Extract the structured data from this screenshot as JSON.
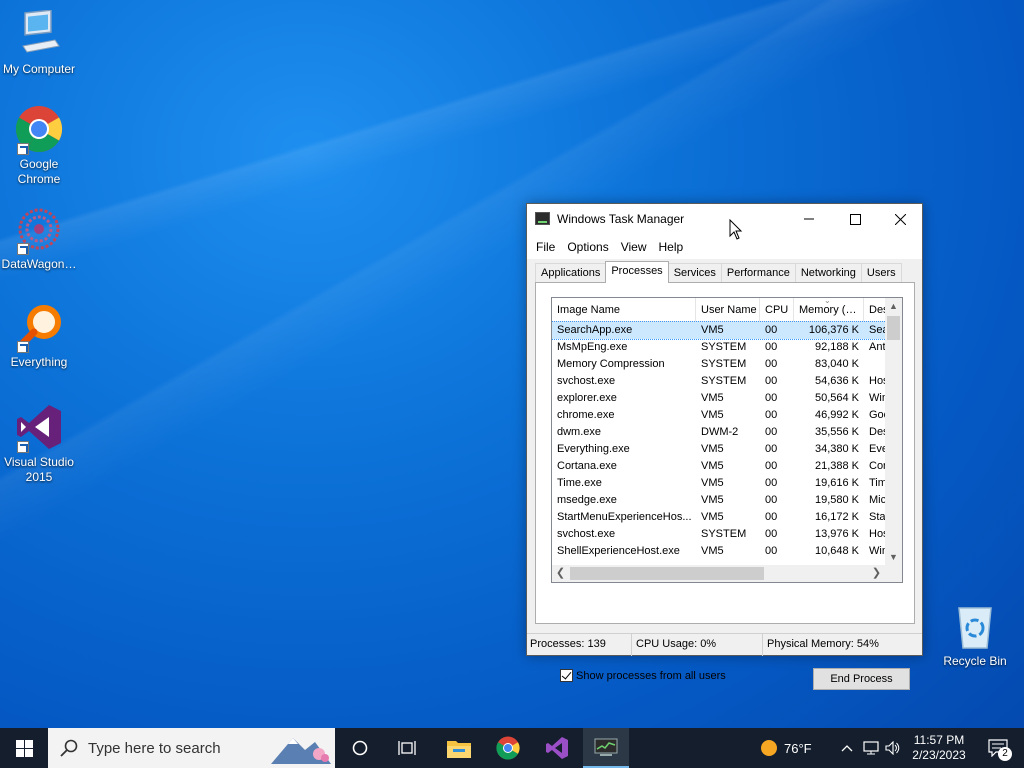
{
  "desktop": {
    "icons": [
      {
        "label": "My Computer",
        "icon": "computer-icon"
      },
      {
        "label": "Google Chrome",
        "icon": "chrome-icon"
      },
      {
        "label": "DataWagon…",
        "icon": "datawagon-icon"
      },
      {
        "label": "Everything",
        "icon": "everything-search-icon"
      },
      {
        "label": "Visual Studio 2015",
        "icon": "visual-studio-icon"
      },
      {
        "label": "Recycle Bin",
        "icon": "recycle-bin-icon"
      }
    ]
  },
  "window": {
    "title": "Windows Task Manager",
    "menu": [
      "File",
      "Options",
      "View",
      "Help"
    ],
    "tabs": [
      "Applications",
      "Processes",
      "Services",
      "Performance",
      "Networking",
      "Users"
    ],
    "active_tab": "Processes",
    "columns": [
      "Image Name",
      "User Name",
      "CPU",
      "Memory (…",
      "Des"
    ],
    "rows": [
      [
        "SearchApp.exe",
        "VM5",
        "00",
        "106,376 K",
        "Sea"
      ],
      [
        "MsMpEng.exe",
        "SYSTEM",
        "00",
        "92,188 K",
        "Ant"
      ],
      [
        "Memory Compression",
        "SYSTEM",
        "00",
        "83,040 K",
        ""
      ],
      [
        "svchost.exe",
        "SYSTEM",
        "00",
        "54,636 K",
        "Hos"
      ],
      [
        "explorer.exe",
        "VM5",
        "00",
        "50,564 K",
        "Win"
      ],
      [
        "chrome.exe",
        "VM5",
        "00",
        "46,992 K",
        "Goo"
      ],
      [
        "dwm.exe",
        "DWM-2",
        "00",
        "35,556 K",
        "Des"
      ],
      [
        "Everything.exe",
        "VM5",
        "00",
        "34,380 K",
        "Eve"
      ],
      [
        "Cortana.exe",
        "VM5",
        "00",
        "21,388 K",
        "Cor"
      ],
      [
        "Time.exe",
        "VM5",
        "00",
        "19,616 K",
        "Tim"
      ],
      [
        "msedge.exe",
        "VM5",
        "00",
        "19,580 K",
        "Mic"
      ],
      [
        "StartMenuExperienceHos...",
        "VM5",
        "00",
        "16,172 K",
        "Sta"
      ],
      [
        "svchost.exe",
        "SYSTEM",
        "00",
        "13,976 K",
        "Hos"
      ],
      [
        "ShellExperienceHost.exe",
        "VM5",
        "00",
        "10,648 K",
        "Win"
      ]
    ],
    "show_all_label": "Show processes from all users",
    "show_all_checked": true,
    "end_process_label": "End Process",
    "status": {
      "processes": "Processes: 139",
      "cpu": "CPU Usage: 0%",
      "memory": "Physical Memory: 54%"
    }
  },
  "taskbar": {
    "search_placeholder": "Type here to search",
    "weather": "76°F",
    "time": "11:57 PM",
    "date": "2/23/2023",
    "notification_count": "2"
  }
}
